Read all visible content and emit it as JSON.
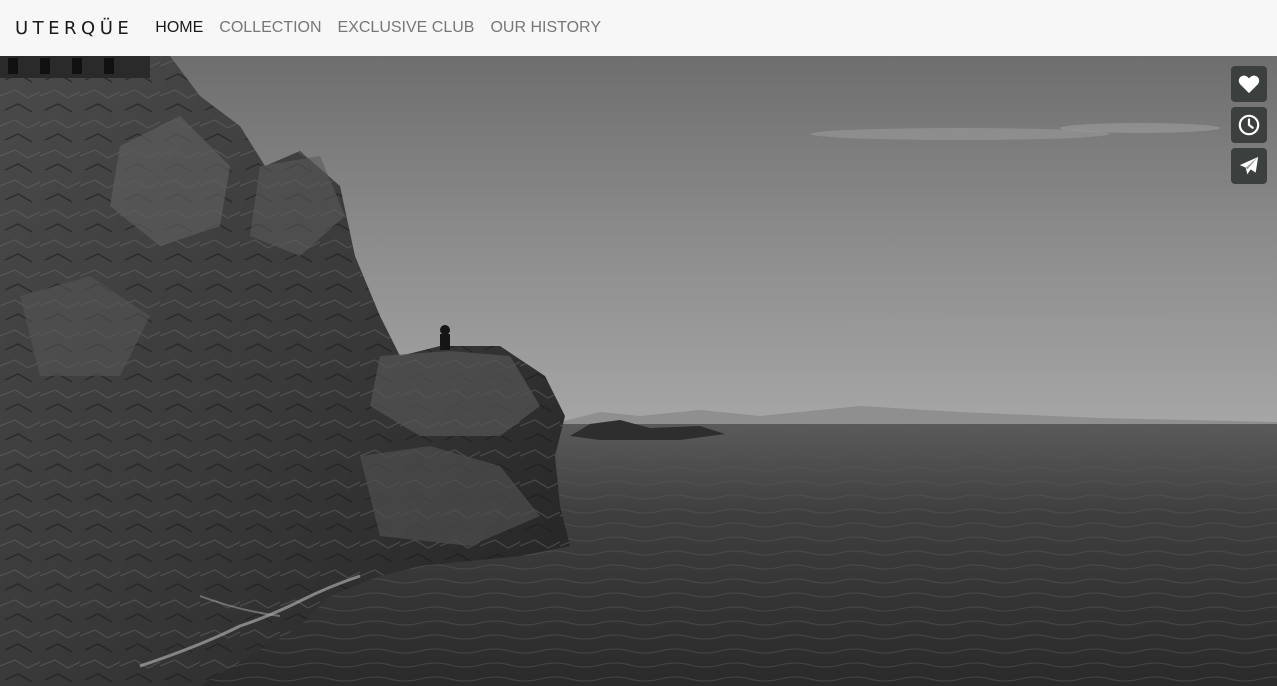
{
  "brand": {
    "name": "UTERQÜE"
  },
  "nav": {
    "items": [
      {
        "label": "HOME",
        "active": true
      },
      {
        "label": "COLLECTION",
        "active": false
      },
      {
        "label": "EXCLUSIVE CLUB",
        "active": false
      },
      {
        "label": "OUR HISTORY",
        "active": false
      }
    ]
  },
  "hero": {
    "image": "black-and-white-coastal-cliffs-sea"
  },
  "actions": [
    {
      "icon": "heart-icon"
    },
    {
      "icon": "clock-icon"
    },
    {
      "icon": "paper-plane-icon"
    }
  ],
  "colors": {
    "navbar_bg": "#f7f7f7",
    "nav_active": "#1a1a1a",
    "nav_inactive": "#777777",
    "action_button_bg": "#3b403f",
    "icon_color": "#ffffff"
  }
}
